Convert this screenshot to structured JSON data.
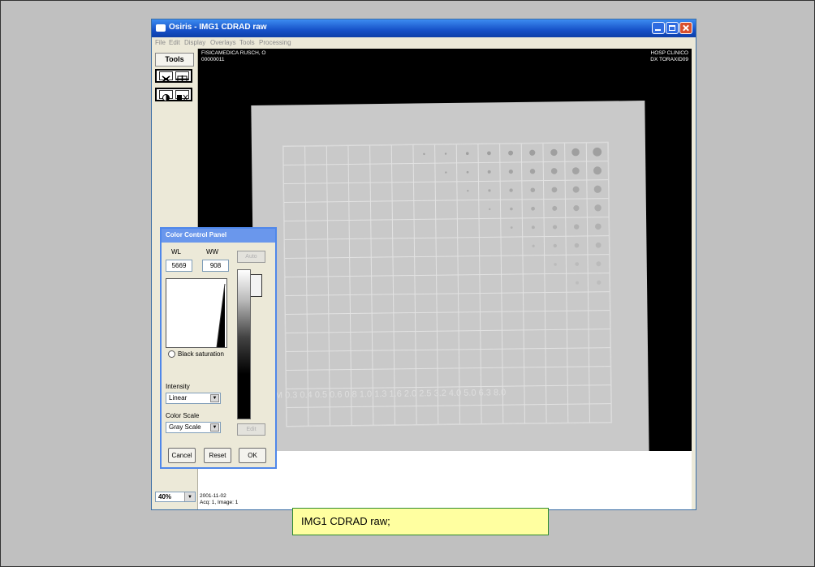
{
  "window": {
    "title": "Osiris - IMG1 CDRAD raw"
  },
  "menu": [
    "File",
    "Edit",
    "Display",
    "Overlays",
    "Tools",
    "Processing"
  ],
  "tools_panel": {
    "tools_label": "Tools",
    "zoom": "40%"
  },
  "overlay": {
    "patient_name": "FISICAMEDICA RUSCH, O",
    "patient_id": "00000011",
    "institution": "HOSP CLINICO",
    "device": "DX TORAXID09",
    "date": "2001-11-02",
    "series_image": "Acq: 1, Image: 1"
  },
  "phantom": {
    "mm_row": "MM 0.3 0.4 0.5 0.6 0.8 1.0 1.3 1.6 2.0 2.5 3.2 4.0 5.0 6.3 8.0"
  },
  "color_control_panel": {
    "title": "Color Control Panel",
    "wl_label": "WL",
    "ww_label": "WW",
    "wl_value": "5669",
    "ww_value": "908",
    "black_saturation": "Black saturation",
    "intensity_label": "Intensity",
    "intensity_value": "Linear",
    "color_scale_label": "Color Scale",
    "color_scale_value": "Gray Scale",
    "top_button": "Auto",
    "bottom_button": "Edit",
    "cancel": "Cancel",
    "reset": "Reset",
    "ok": "OK"
  },
  "caption": "IMG1 CDRAD raw;"
}
